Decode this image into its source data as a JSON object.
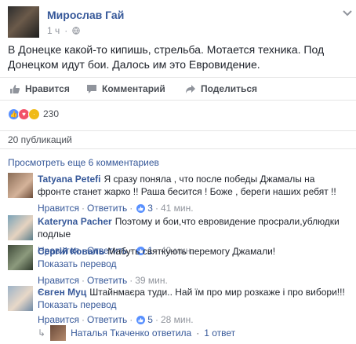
{
  "post": {
    "author": "Мирослав Гай",
    "time": "1 ч",
    "text": "В Донецке какой-то кипишь, стрельба. Мотается техника. Под Донецком идут бои. Далось им это Евровидение."
  },
  "actions": {
    "like": "Нравится",
    "comment": "Комментарий",
    "share": "Поделиться"
  },
  "reactions": {
    "count": "230"
  },
  "shares": "20 публикаций",
  "view_more": "Просмотреть еще 6 комментариев",
  "comments": [
    {
      "name": "Tatyana Petefi",
      "text": "Я сразу поняла , что после победы Джамалы на фронте станет жарко !! Раша бесится ! Боже , береги наших ребят !!",
      "like": "Нравится",
      "reply": "Ответить",
      "likes": "3",
      "time": "41 мин."
    },
    {
      "name": "Kateryna Pacher",
      "text": "Поэтому и бои,что евровидение просрали,ублюдки подлые",
      "like": "Нравится",
      "reply": "Ответить",
      "likes": "1",
      "time": "40 мин."
    },
    {
      "name": "Сергій Коваль",
      "text": "Мабуть святкують перемогу Джамали!",
      "translate": "Показать перевод",
      "like": "Нравится",
      "reply": "Ответить",
      "time": "39 мин."
    },
    {
      "name": "Євген Муц",
      "text": "Штайнмаєра туди.. Най їм про мир розкаже і про вибори!!!",
      "translate": "Показать перевод",
      "like": "Нравится",
      "reply": "Ответить",
      "likes": "5",
      "time": "28 мин."
    }
  ],
  "reply_summary": {
    "text": "Наталья Ткаченко ответила",
    "count": "1 ответ"
  },
  "sep": "·",
  "colors": {
    "link": "#365899",
    "like_blue": "#5890ff",
    "angry": "#f0ba15",
    "love": "#f25268"
  }
}
